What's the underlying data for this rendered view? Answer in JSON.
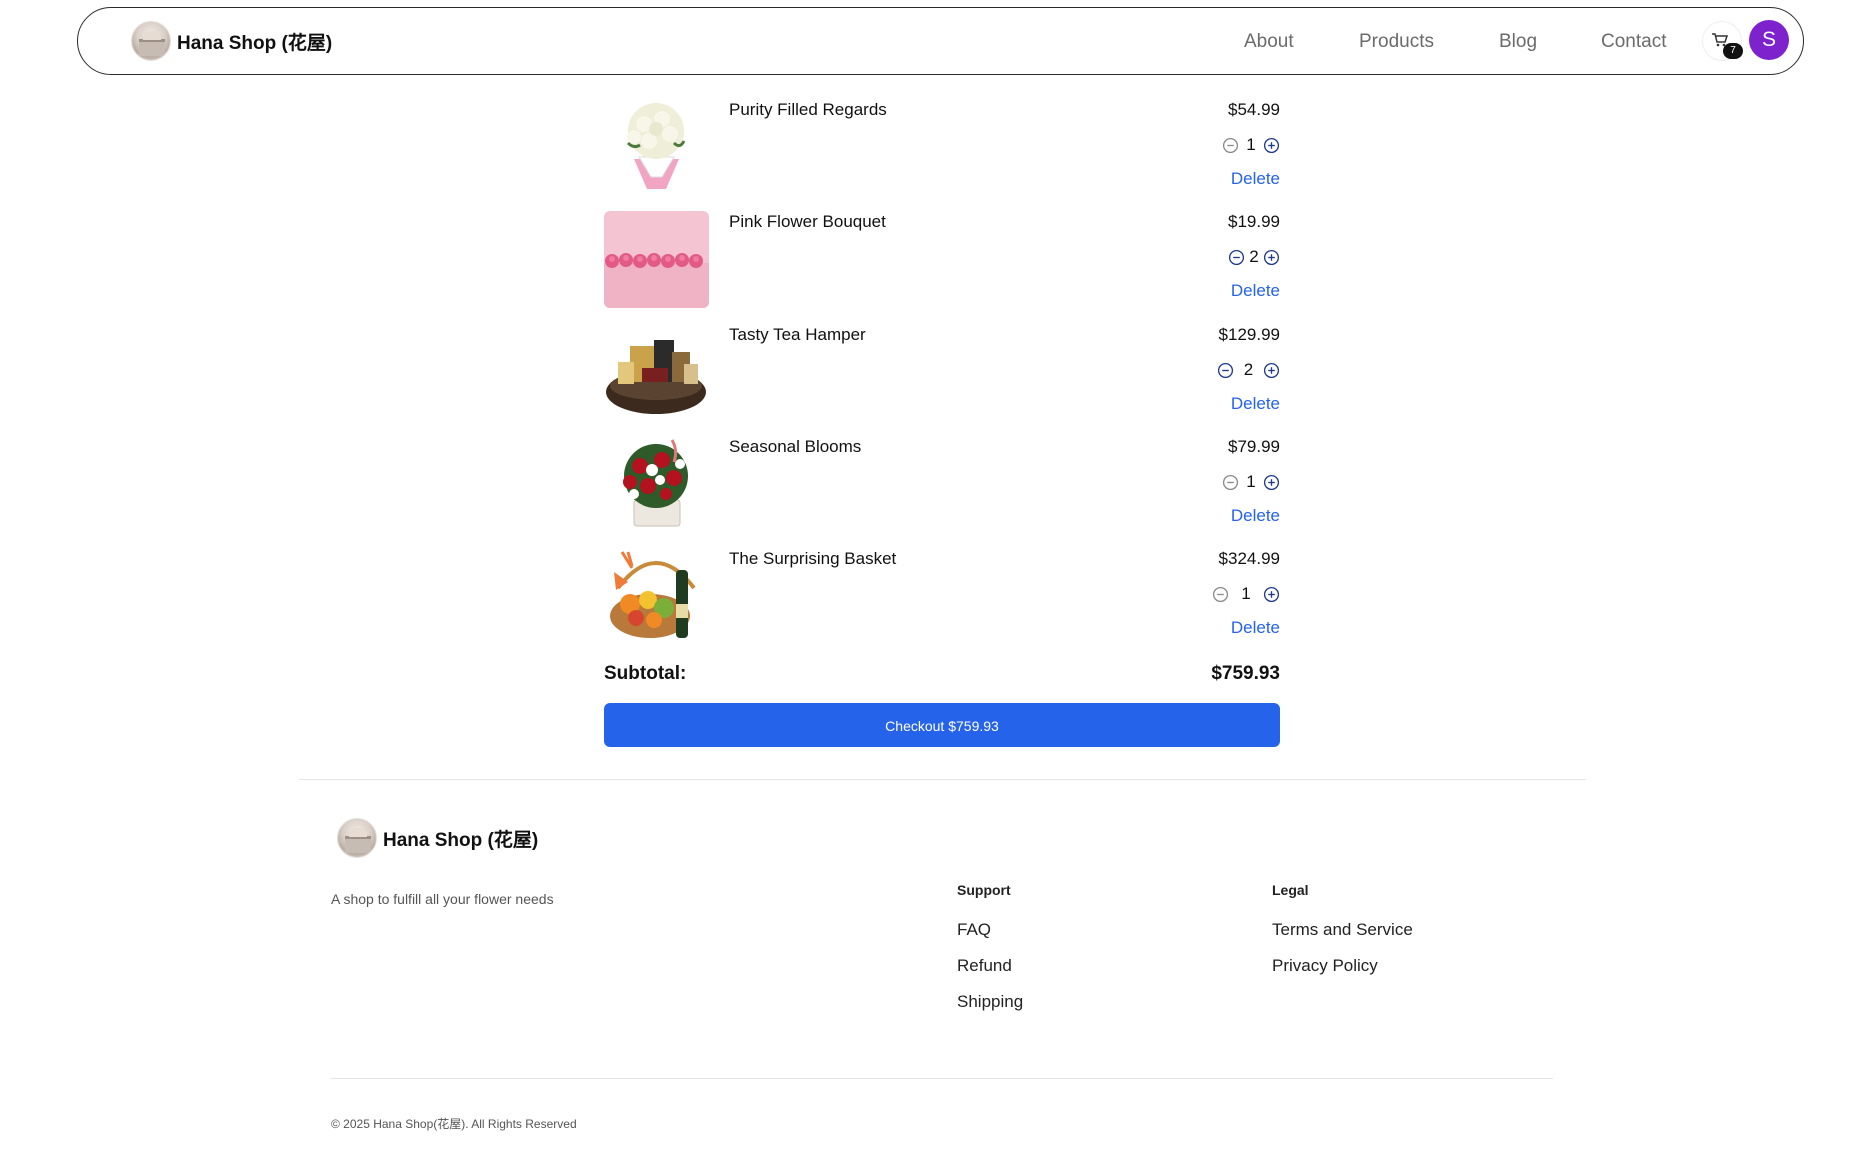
{
  "navbar": {
    "brand": "Hana Shop (花屋)",
    "links": [
      "About",
      "Products",
      "Blog",
      "Contact"
    ],
    "cart_count": "7",
    "avatar_initial": "S"
  },
  "cart": {
    "items": [
      {
        "name": "Purity Filled Regards",
        "price": "$54.99",
        "quantity": "1",
        "delete_label": "Delete"
      },
      {
        "name": "Pink Flower Bouquet",
        "price": "$19.99",
        "quantity": "2",
        "delete_label": "Delete"
      },
      {
        "name": "Tasty Tea Hamper",
        "price": "$129.99",
        "quantity": "2",
        "delete_label": "Delete"
      },
      {
        "name": "Seasonal Blooms",
        "price": "$79.99",
        "quantity": "1",
        "delete_label": "Delete"
      },
      {
        "name": "The Surprising Basket",
        "price": "$324.99",
        "quantity": "1",
        "delete_label": "Delete"
      }
    ],
    "subtotal_label": "Subtotal:",
    "subtotal_value": "$759.93",
    "checkout_label": "Checkout $759.93"
  },
  "footer": {
    "brand": "Hana Shop (花屋)",
    "tagline": "A shop to fulfill all your flower needs",
    "support": {
      "title": "Support",
      "links": [
        "FAQ",
        "Refund",
        "Shipping"
      ]
    },
    "legal": {
      "title": "Legal",
      "links": [
        "Terms and Service",
        "Privacy Policy"
      ]
    },
    "copyright": "© 2025 Hana Shop(花屋). All Rights Reserved"
  },
  "colors": {
    "accent_blue": "#2563eb",
    "avatar_purple": "#7e22ce",
    "minus_disabled": "#8a8a8a",
    "minus_active": "#1e3a8a",
    "plus_active": "#1e3a8a"
  },
  "icons": [
    "cart-icon",
    "minus-circle-icon",
    "plus-circle-icon",
    "shop-logo-icon"
  ]
}
